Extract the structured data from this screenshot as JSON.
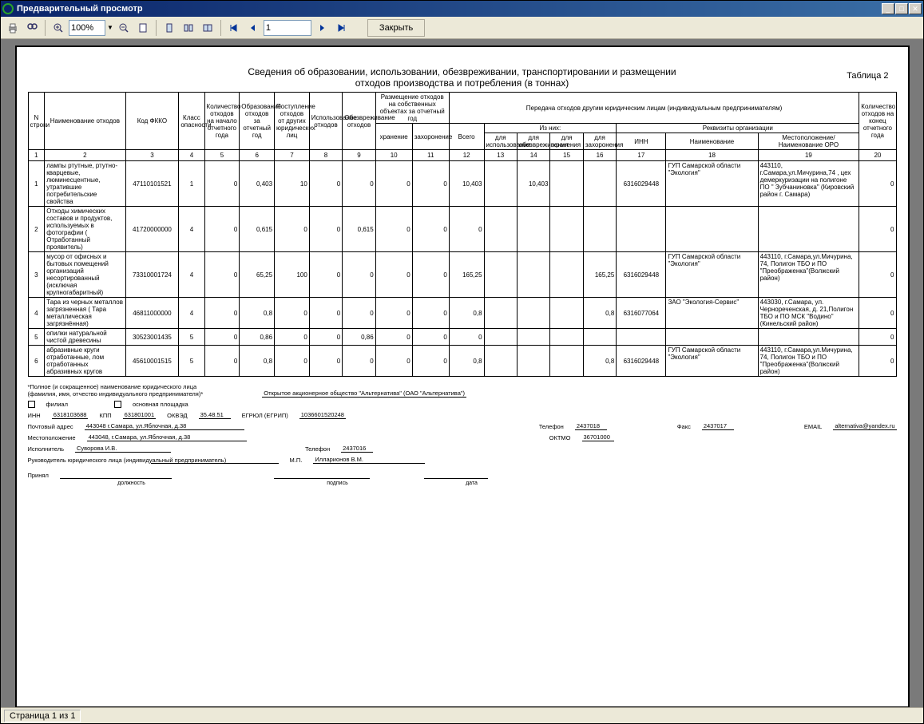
{
  "window": {
    "title": "Предварительный просмотр"
  },
  "toolbar": {
    "zoom": "100%",
    "page": "1",
    "close": "Закрыть"
  },
  "report": {
    "title_line1": "Сведения об образовании, использовании, обезвреживании, транспортировании и размещении",
    "title_line2": "отходов производства и потребления (в тоннах)",
    "table_label": "Таблица 2",
    "headers": {
      "n": "N строки",
      "name": "Наименование отходов",
      "code": "Код ФККО",
      "class": "Класс опасности",
      "qty_start": "Количество отходов на начало отчетного года",
      "formed": "Образование отходов за отчетный год",
      "received": "Поступление отходов от других юридических лиц",
      "used": "Использование отходов",
      "neutralized": "Обезвреживание отходов",
      "placement_group": "Размещение отходов на собственных объектах за отчетный год",
      "storage": "хранение",
      "burial": "захоронение",
      "transfer_group": "Передача отходов другим юридическим лицам (индивидуальным предпринимателям)",
      "total": "Всего",
      "of_which": "Из них:",
      "for_use": "для использования",
      "for_neutral": "для обезвреживания",
      "for_storage": "для хранения",
      "for_burial": "для захоронения",
      "requisites": "Реквизиты организации",
      "inn": "ИНН",
      "org_name": "Наименование",
      "location_oro": "Местоположение/ Наименование ОРО",
      "qty_end": "Количество отходов на конец отчетного года"
    },
    "colnums": [
      "1",
      "2",
      "3",
      "4",
      "5",
      "6",
      "7",
      "8",
      "9",
      "10",
      "11",
      "12",
      "13",
      "14",
      "15",
      "16",
      "17",
      "18",
      "19",
      "20"
    ],
    "rows": [
      {
        "n": "1",
        "name": "лампы ртутные, ртутно-кварцевые, люминесцентные, утратившие потребительские свойства",
        "code": "47110101521",
        "class": "1",
        "qty_start": "0",
        "formed": "0,403",
        "received": "10",
        "used": "0",
        "neutral": "0",
        "storage": "0",
        "burial": "0",
        "total": "10,403",
        "for_use": "",
        "for_neutral": "10,403",
        "for_storage": "",
        "for_burial": "",
        "inn": "6316029448",
        "org": "ГУП Самарской области \"Экология\"",
        "loc": "443110, г.Самара,ул.Мичурина,74 , цех демеркуризации на полигоне ПО \" Зубчаниновка\" (Кировский район г. Самара)",
        "qty_end": "0"
      },
      {
        "n": "2",
        "name": "Отходы химических составов и продуктов, используемых в фотографии ( Отработанный проявитель)",
        "code": "41720000000",
        "class": "4",
        "qty_start": "0",
        "formed": "0,615",
        "received": "0",
        "used": "0",
        "neutral": "0,615",
        "storage": "0",
        "burial": "0",
        "total": "0",
        "for_use": "",
        "for_neutral": "",
        "for_storage": "",
        "for_burial": "",
        "inn": "",
        "org": "",
        "loc": "",
        "qty_end": "0"
      },
      {
        "n": "3",
        "name": "мусор от офисных и бытовых помещений организаций несортированный (исключая крупногабаритный)",
        "code": "73310001724",
        "class": "4",
        "qty_start": "0",
        "formed": "65,25",
        "received": "100",
        "used": "0",
        "neutral": "0",
        "storage": "0",
        "burial": "0",
        "total": "165,25",
        "for_use": "",
        "for_neutral": "",
        "for_storage": "",
        "for_burial": "165,25",
        "inn": "6316029448",
        "org": "ГУП Самарской области \"Экология\"",
        "loc": "443110, г.Самара,ул.Мичурина, 74, Полигон ТБО и ПО \"Преображенка\"(Волжский район)",
        "qty_end": "0"
      },
      {
        "n": "4",
        "name": "Тара из черных металлов загрязненная ( Тара металлическая загрязнённая)",
        "code": "46811000000",
        "class": "4",
        "qty_start": "0",
        "formed": "0,8",
        "received": "0",
        "used": "0",
        "neutral": "0",
        "storage": "0",
        "burial": "0",
        "total": "0,8",
        "for_use": "",
        "for_neutral": "",
        "for_storage": "",
        "for_burial": "0,8",
        "inn": "6316077064",
        "org": "ЗАО \"Экология-Сервис\"",
        "loc": "443030, г.Самара, ул. Чернореченская, д. 21,Полигон ТБО и ПО МСК \"Водино\" (Кинельский район)",
        "qty_end": "0"
      },
      {
        "n": "5",
        "name": "опилки натуральной чистой древесины",
        "code": "30523001435",
        "class": "5",
        "qty_start": "0",
        "formed": "0,86",
        "received": "0",
        "used": "0",
        "neutral": "0,86",
        "storage": "0",
        "burial": "0",
        "total": "0",
        "for_use": "",
        "for_neutral": "",
        "for_storage": "",
        "for_burial": "",
        "inn": "",
        "org": "",
        "loc": "",
        "qty_end": "0"
      },
      {
        "n": "6",
        "name": "абразивные круги отработанные, лом отработанных абразивных кругов",
        "code": "45610001515",
        "class": "5",
        "qty_start": "0",
        "formed": "0,8",
        "received": "0",
        "used": "0",
        "neutral": "0",
        "storage": "0",
        "burial": "0",
        "total": "0,8",
        "for_use": "",
        "for_neutral": "",
        "for_storage": "",
        "for_burial": "0,8",
        "inn": "6316029448",
        "org": "ГУП Самарской области \"Экология\"",
        "loc": "443110, г.Самара,ул.Мичурина, 74, Полигон ТБО и ПО \"Преображенка\"(Волжский район)",
        "qty_end": "0"
      }
    ]
  },
  "footer": {
    "note1": "*Полное (и сокращенное) наименование юридического лица",
    "note2": "(фамилия, имя, отчество индивидуального предпринимателя)*",
    "company": "Открытое акционерное общество \"Альтернатива\" (ОАО \"Альтернатива\")",
    "filial": "филиал",
    "main_site": "основная площадка",
    "inn_lbl": "ИНН",
    "inn": "6318103688",
    "kpp_lbl": "КПП",
    "kpp": "631801001",
    "okved_lbl": "ОКВЭД",
    "okved": "35.48.51",
    "egr_lbl": "ЕГРЮЛ (ЕГРИП)",
    "egr": "1036601520248",
    "addr_lbl": "Почтовый адрес",
    "addr": "443048    г.Самара, ул.Яблочная, д.38",
    "tel_lbl": "Телефон",
    "tel": "2437018",
    "fax_lbl": "Факс",
    "fax": "2437017",
    "email_lbl": "EMAIL",
    "email": "alternativa@yandex.ru",
    "loc_lbl": "Местоположение",
    "loc": "443048, г.Самара, ул.Яблочная, д.38",
    "oktmo_lbl": "ОКТМО",
    "oktmo": "36701000",
    "exec_lbl": "Исполнитель",
    "exec": "Суворова И.В.",
    "exec_tel_lbl": "Телефон",
    "exec_tel": "2437016",
    "head_lbl": "Руководитель юридического лица (индивидуальный предприниматель)",
    "head": "Илларионов В.М.",
    "mp": "М.П.",
    "accepted": "Принял",
    "position": "должность",
    "signature": "подпись",
    "date": "дата"
  },
  "status": {
    "page": "Страница 1 из 1"
  }
}
